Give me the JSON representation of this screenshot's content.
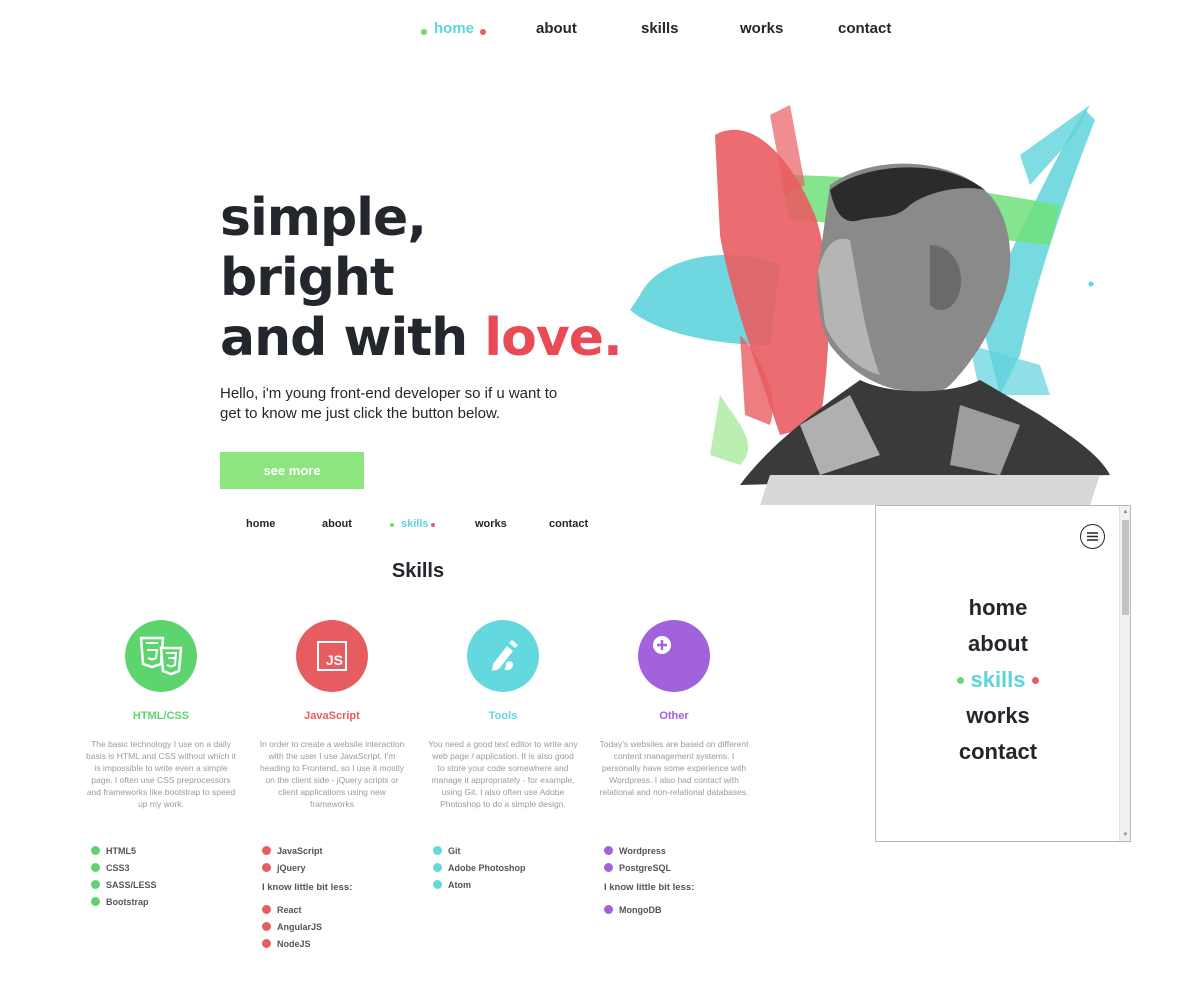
{
  "top_nav": {
    "items": [
      "home",
      "about",
      "skills",
      "works",
      "contact"
    ],
    "active": "home"
  },
  "hero": {
    "line1": "simple,",
    "line2": "bright",
    "line3": "and with ",
    "love": "love.",
    "subtitle": "Hello, i'm young front-end developer so if u want to get to know me just click the button below.",
    "button": "see more"
  },
  "section_nav": {
    "items": [
      "home",
      "about",
      "skills",
      "works",
      "contact"
    ],
    "active": "skills"
  },
  "skills": {
    "heading": "Skills",
    "columns": [
      {
        "title": "HTML/CSS",
        "color": "#5ed46f",
        "icon": "html5-css3-icon",
        "desc": "The basic technology I use on a daily basis is HTML and CSS without which it is impossible to write even a simple page. I often use CSS preprocessors and frameworks like bootstrap to speed up my work.",
        "list": [
          "HTML5",
          "CSS3",
          "SASS/LESS",
          "Bootstrap"
        ],
        "less_label": "",
        "less_list": []
      },
      {
        "title": "JavaScript",
        "color": "#e65c60",
        "icon": "js-icon",
        "icon_text": "JS",
        "desc": "In order to create a website interaction with the user I use JavaScript. I'm heading to Frontend, so I use it mostly on the client side - jQuery scripts or client applications using new frameworks",
        "list": [
          "JavaScript",
          "jQuery"
        ],
        "less_label": "I know little bit less:",
        "less_list": [
          "React",
          "AngularJS",
          "NodeJS"
        ]
      },
      {
        "title": "Tools",
        "color": "#63d8de",
        "icon": "pencil-brush-icon",
        "desc": "You need a good text editor to write any web page / application. It is also good to store your code somewhere and manage it appropriately - for example, using Git. I also often use Adobe Photoshop to do a simple design.",
        "list": [
          "Git",
          "Adobe Photoshop",
          "Atom"
        ],
        "less_label": "",
        "less_list": []
      },
      {
        "title": "Other",
        "color": "#a162db",
        "icon": "plus-circle-icon",
        "desc": "Today's websites are based on different content management systems. I personally have some experience with Wordpress. I also had contact with relational and non-relational databases.",
        "list": [
          "Wordpress",
          "PostgreSQL"
        ],
        "less_label": "I know little bit less:",
        "less_list": [
          "MongoDB"
        ]
      }
    ]
  },
  "menu_panel": {
    "items": [
      "home",
      "about",
      "skills",
      "works",
      "contact"
    ],
    "active": "skills"
  },
  "colors": {
    "accent_cyan": "#5fd3dc",
    "accent_red": "#e84a56",
    "accent_green": "#8ee47f",
    "text_dark": "#23262d"
  }
}
